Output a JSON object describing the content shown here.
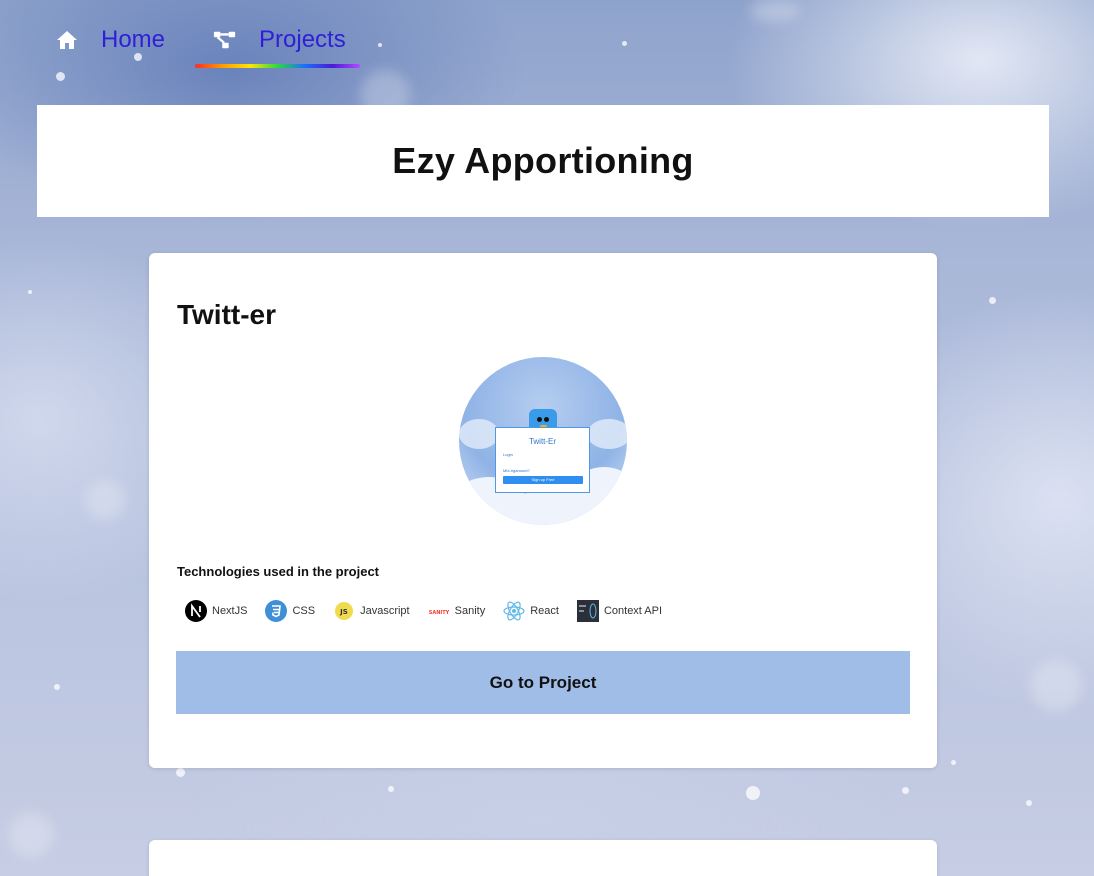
{
  "nav": {
    "items": [
      {
        "label": "Home",
        "icon": "home-icon"
      },
      {
        "label": "Projects",
        "icon": "project-diagram-icon"
      }
    ],
    "active": "Projects",
    "link_color": "#2f1fd6"
  },
  "page": {
    "title": "Ezy Apportioning"
  },
  "project": {
    "title": "Twitt-er",
    "preview": {
      "app_name": "Twitt-Er",
      "login_label": "Login",
      "small_text": "Mid-rigamund?",
      "button_label": "Sign up Free"
    },
    "technologies_heading": "Technologies used in the project",
    "technologies": [
      {
        "label": "NextJS",
        "icon": "nextjs-icon"
      },
      {
        "label": "CSS",
        "icon": "css3-icon"
      },
      {
        "label": "Javascript",
        "icon": "javascript-icon"
      },
      {
        "label": "Sanity",
        "icon": "sanity-icon"
      },
      {
        "label": "React",
        "icon": "react-icon"
      },
      {
        "label": "Context API",
        "icon": "context-api-icon"
      }
    ],
    "cta_label": "Go to Project",
    "cta_color": "#9fbde6"
  }
}
